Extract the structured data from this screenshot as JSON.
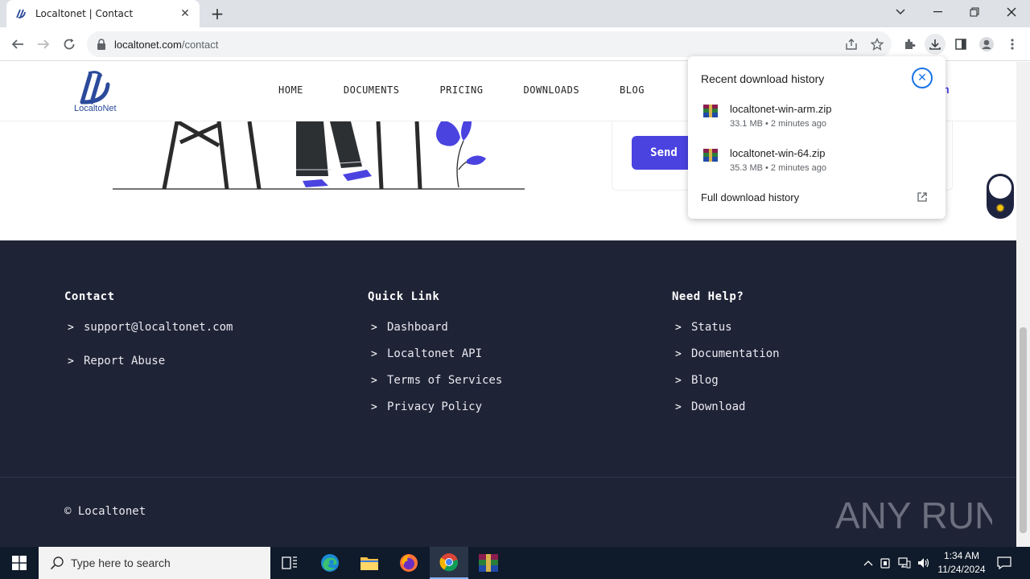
{
  "browser": {
    "tab_title": "Localtonet | Contact",
    "url_host": "localtonet.com",
    "url_path": "/contact"
  },
  "site": {
    "brand": "LocaltoNet",
    "nav": [
      "HOME",
      "DOCUMENTS",
      "PRICING",
      "DOWNLOADS",
      "BLOG"
    ],
    "nav_partial": "n",
    "send_label": "Send"
  },
  "footer": {
    "contact": {
      "heading": "Contact",
      "items": [
        "support@localtonet.com",
        "Report Abuse"
      ]
    },
    "quick_link": {
      "heading": "Quick Link",
      "items": [
        "Dashboard",
        "Localtonet API",
        "Terms of Services",
        "Privacy Policy"
      ]
    },
    "need_help": {
      "heading": "Need Help?",
      "items": [
        "Status",
        "Documentation",
        "Blog",
        "Download"
      ]
    },
    "copyright": "© Localtonet",
    "watermark": "ANY RUN"
  },
  "downloads": {
    "heading": "Recent download history",
    "items": [
      {
        "name": "localtonet-win-arm.zip",
        "meta": "33.1 MB • 2 minutes ago"
      },
      {
        "name": "localtonet-win-64.zip",
        "meta": "35.3 MB • 2 minutes ago"
      }
    ],
    "full_history": "Full download history"
  },
  "taskbar": {
    "search_placeholder": "Type here to search",
    "time": "1:34 AM",
    "date": "11/24/2024"
  },
  "colors": {
    "accent": "#4a43e0",
    "footer_bg": "#1f2336",
    "chrome_blue": "#1a73e8"
  }
}
